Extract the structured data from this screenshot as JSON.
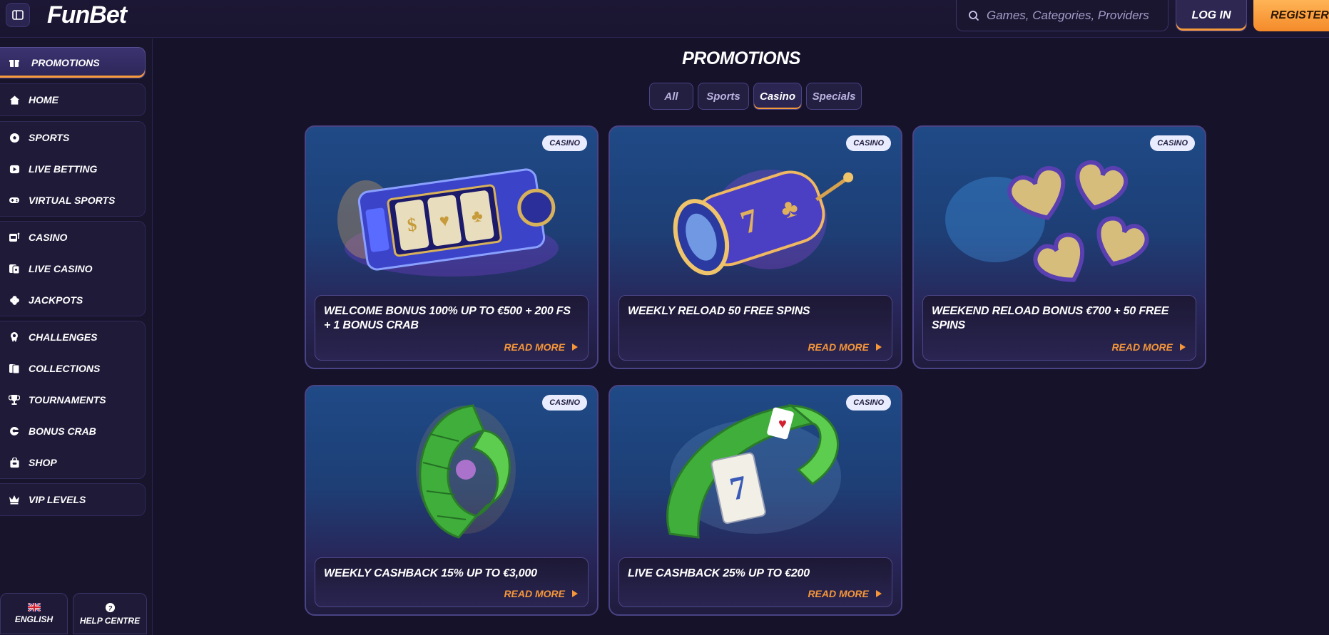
{
  "header": {
    "logo": "FunBet",
    "search_placeholder": "Games, Categories, Providers",
    "login_label": "LOG IN",
    "register_label": "REGISTER"
  },
  "sidebar": {
    "promotions": "PROMOTIONS",
    "group1": [
      {
        "label": "HOME",
        "icon": "home-icon"
      }
    ],
    "group2": [
      {
        "label": "SPORTS",
        "icon": "soccer-ball-icon"
      },
      {
        "label": "LIVE BETTING",
        "icon": "live-play-icon"
      },
      {
        "label": "VIRTUAL SPORTS",
        "icon": "gamepad-icon"
      }
    ],
    "group3": [
      {
        "label": "CASINO",
        "icon": "slot-machine-icon"
      },
      {
        "label": "LIVE CASINO",
        "icon": "live-cards-icon"
      },
      {
        "label": "JACKPOTS",
        "icon": "clover-icon"
      }
    ],
    "group4": [
      {
        "label": "CHALLENGES",
        "icon": "medal-icon"
      },
      {
        "label": "COLLECTIONS",
        "icon": "cards-icon"
      },
      {
        "label": "TOURNAMENTS",
        "icon": "trophy-icon"
      },
      {
        "label": "BONUS CRAB",
        "icon": "crab-icon"
      },
      {
        "label": "SHOP",
        "icon": "shop-bag-icon"
      }
    ],
    "group5": [
      {
        "label": "VIP LEVELS",
        "icon": "crown-icon"
      }
    ],
    "language": "ENGLISH",
    "help": "HELP CENTRE"
  },
  "main": {
    "title": "PROMOTIONS",
    "tabs": [
      "All",
      "Sports",
      "Casino",
      "Specials"
    ],
    "active_tab": "Casino",
    "cards": [
      {
        "badge": "CASINO",
        "title": "WELCOME BONUS 100% UP TO €500 + 200 FS + 1 BONUS CRAB",
        "cta": "READ MORE"
      },
      {
        "badge": "CASINO",
        "title": "WEEKLY RELOAD 50 FREE SPINS",
        "cta": "READ MORE"
      },
      {
        "badge": "CASINO",
        "title": "WEEKEND RELOAD BONUS €700 + 50 FREE SPINS",
        "cta": "READ MORE"
      },
      {
        "badge": "CASINO",
        "title": "WEEKLY CASHBACK 15% UP TO €3,000",
        "cta": "READ MORE"
      },
      {
        "badge": "CASINO",
        "title": "LIVE CASHBACK 25% UP TO €200",
        "cta": "READ MORE"
      }
    ]
  },
  "colors": {
    "accent": "#f79a3a",
    "background": "#15122a",
    "panel": "#1e1a38",
    "border": "#4a4385"
  }
}
